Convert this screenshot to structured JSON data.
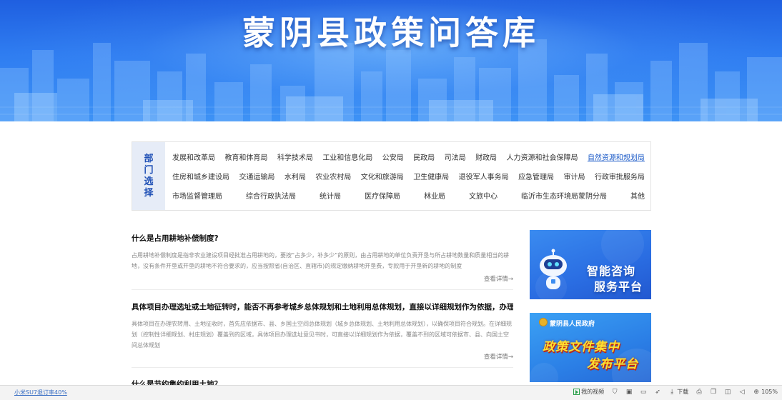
{
  "banner": {
    "title": "蒙阴县政策问答库"
  },
  "departments": {
    "side_label": [
      "部",
      "门",
      "选",
      "择"
    ],
    "rows": [
      [
        "发展和改革局",
        "教育和体育局",
        "科学技术局",
        "工业和信息化局",
        "公安局",
        "民政局",
        "司法局",
        "财政局",
        "人力资源和社会保障局",
        "自然资源和规划局"
      ],
      [
        "住房和城乡建设局",
        "交通运输局",
        "水利局",
        "农业农村局",
        "文化和旅游局",
        "卫生健康局",
        "退役军人事务局",
        "应急管理局",
        "审计局",
        "行政审批服务局"
      ],
      [
        "市场监督管理局",
        "综合行政执法局",
        "统计局",
        "医疗保障局",
        "林业局",
        "文旅中心",
        "临沂市生态环境局蒙阴分局",
        "其他"
      ]
    ],
    "active": "自然资源和规划局"
  },
  "articles": [
    {
      "title": "什么是占用耕地补偿制度?",
      "summary": "占用耕地补偿制度是指非农业建设项目经批准占用耕地的，要按“占多少，补多少”的原则，由占用耕地的单位负责开垦与所占耕地数量和质量相当的耕地，没有条件开垦或开垦的耕地不符合要求的，应当按照省(自治区、直辖市)的规定缴纳耕地开垦费，专款用于开垦新的耕地的制度",
      "more": "查看详情→"
    },
    {
      "title": "具体项目办理选址或土地征转时，能否不再参考城乡总体规划和土地利用总体规划，直接以详细规划作为依据，办理项目规…",
      "summary": "具体项目在办理农转用、土地征收时，首先应依据市、县、乡国土空间总体规划（城乡总体规划、土地利用总体规划），以确保项目符合规划。在详细规划（控制性详细规划、村庄规划）覆盖到的区域，具体项目办理选址意见书时，可直接以详细规划作为依据，覆盖不到的区域可依据市、县、向国土空间总体规划",
      "more": "查看详情→"
    },
    {
      "title": "什么是节约集约利用土地？",
      "summary": "",
      "more": ""
    }
  ],
  "cards": {
    "card1": {
      "line1": "智能咨询",
      "line2": "服务平台"
    },
    "card2": {
      "gov": "蒙阴县人民政府",
      "line1": "政策文件集中",
      "line2": "发布平台"
    }
  },
  "statusbar": {
    "left": "小米SU7退订率40%",
    "items": [
      "我的视频",
      "下载",
      "105%"
    ]
  },
  "colors": {
    "banner": "#2f7df1",
    "accent": "#1e5cc8",
    "slogan": "#ffe030"
  }
}
